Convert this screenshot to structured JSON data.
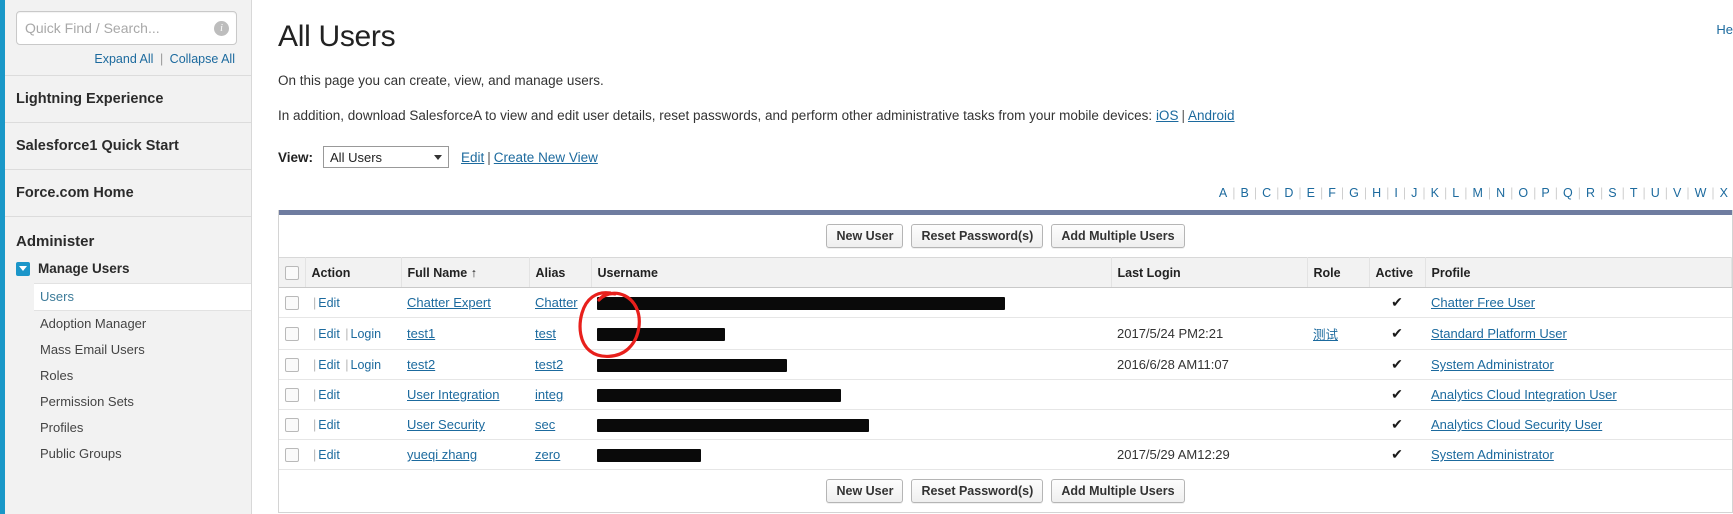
{
  "sidebar": {
    "search": {
      "placeholder": "Quick Find / Search...",
      "value": "",
      "help_icon": "info-icon",
      "search_icon": "search-icon"
    },
    "expand_all": "Expand All",
    "collapse_all": "Collapse All",
    "separator": "|",
    "top_items": [
      {
        "label": "Lightning Experience"
      },
      {
        "label": "Salesforce1 Quick Start"
      },
      {
        "label": "Force.com Home"
      }
    ],
    "section_title": "Administer",
    "group": {
      "label": "Manage Users",
      "twisty_icon": "chevron-down-icon",
      "items": [
        {
          "label": "Users",
          "active": true
        },
        {
          "label": "Adoption Manager",
          "active": false
        },
        {
          "label": "Mass Email Users",
          "active": false
        },
        {
          "label": "Roles",
          "active": false
        },
        {
          "label": "Permission Sets",
          "active": false
        },
        {
          "label": "Profiles",
          "active": false
        },
        {
          "label": "Public Groups",
          "active": false
        }
      ]
    }
  },
  "main": {
    "help_link": "He",
    "title": "All Users",
    "intro_line1": "On this page you can create, view, and manage users.",
    "intro_line2_prefix": "In addition, download SalesforceA to view and edit user details, reset passwords, and perform other administrative tasks from your mobile devices: ",
    "intro_link_ios": "iOS",
    "intro_link_android": "Android",
    "view": {
      "label": "View:",
      "selected": "All Users",
      "caret_icon": "chevron-down-icon",
      "edit_link": "Edit",
      "create_link": "Create New View",
      "separator": "|"
    },
    "alphabet": [
      "A",
      "B",
      "C",
      "D",
      "E",
      "F",
      "G",
      "H",
      "I",
      "J",
      "K",
      "L",
      "M",
      "N",
      "O",
      "P",
      "Q",
      "R",
      "S",
      "T",
      "U",
      "V",
      "W",
      "X"
    ],
    "buttons": {
      "new_user": "New User",
      "reset_passwords": "Reset Password(s)",
      "add_multiple": "Add Multiple Users"
    },
    "table": {
      "columns": [
        "Action",
        "Full Name",
        "Alias",
        "Username",
        "Last Login",
        "Role",
        "Active",
        "Profile"
      ],
      "sort_indicator": "↑",
      "sorted_column": "Full Name",
      "action_edit": "Edit",
      "action_login": "Login",
      "action_bar": "|",
      "active_check": "✔",
      "rows": [
        {
          "has_login": false,
          "full_name": "Chatter Expert",
          "alias": "Chatter",
          "username_redacted_width": 408,
          "last_login": "",
          "role": "",
          "active": "✔",
          "profile": "Chatter Free User"
        },
        {
          "has_login": true,
          "full_name": "test1",
          "alias": "test",
          "username_redacted_width": 128,
          "last_login": "2017/5/24 PM2:21",
          "role": "测试",
          "active": "✔",
          "profile": "Standard Platform User"
        },
        {
          "has_login": true,
          "full_name": "test2",
          "alias": "test2",
          "username_redacted_width": 190,
          "last_login": "2016/6/28 AM11:07",
          "role": "",
          "active": "✔",
          "profile": "System Administrator"
        },
        {
          "has_login": false,
          "full_name": "User Integration",
          "alias": "integ",
          "username_redacted_width": 244,
          "last_login": "",
          "role": "",
          "active": "✔",
          "profile": "Analytics Cloud Integration User"
        },
        {
          "has_login": false,
          "full_name": "User Security",
          "alias": "sec",
          "username_redacted_width": 272,
          "last_login": "",
          "role": "",
          "active": "✔",
          "profile": "Analytics Cloud Security User"
        },
        {
          "has_login": false,
          "full_name": "yueqi zhang",
          "alias": "zero",
          "username_redacted_width": 104,
          "last_login": "2017/5/29 AM12:29",
          "role": "",
          "active": "✔",
          "profile": "System Administrator"
        }
      ]
    },
    "annotation": {
      "type": "hand-drawn-circle",
      "color": "#e8201c",
      "targets": "Login links for test1 and test2"
    }
  }
}
